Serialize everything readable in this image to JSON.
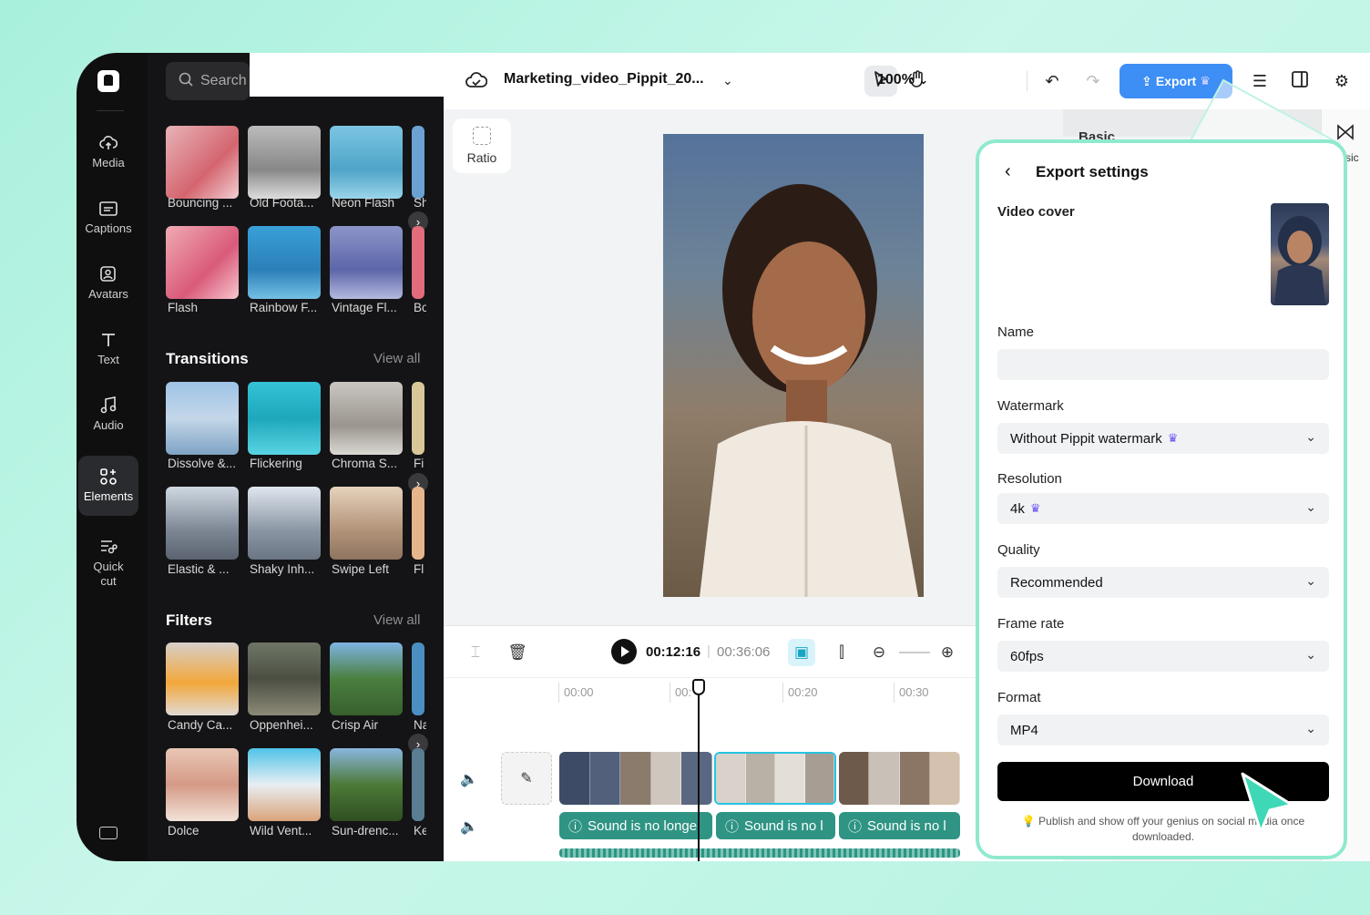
{
  "rail": {
    "items": [
      {
        "label": "Media",
        "icon": "cloud-icon"
      },
      {
        "label": "Captions",
        "icon": "captions-icon"
      },
      {
        "label": "Avatars",
        "icon": "avatar-icon"
      },
      {
        "label": "Text",
        "icon": "text-icon"
      },
      {
        "label": "Audio",
        "icon": "music-icon"
      },
      {
        "label": "Elements",
        "icon": "elements-icon"
      },
      {
        "label": "Quick cut",
        "icon": "quick-cut-icon"
      }
    ],
    "active": "Elements"
  },
  "library": {
    "search_placeholder": "Search",
    "effects_row1": [
      "Bouncing ...",
      "Old Foota...",
      "Neon Flash",
      "Sh"
    ],
    "effects_row2": [
      "Flash",
      "Rainbow F...",
      "Vintage Fl...",
      "Bo"
    ],
    "transitions": {
      "title": "Transitions",
      "view_all": "View all",
      "row1": [
        "Dissolve &...",
        "Flickering",
        "Chroma S...",
        "Fi"
      ],
      "row2": [
        "Elastic & ...",
        "Shaky Inh...",
        "Swipe Left",
        "Fl"
      ]
    },
    "filters": {
      "title": "Filters",
      "view_all": "View all",
      "row1": [
        "Candy Ca...",
        "Oppenhei...",
        "Crisp Air",
        "Na"
      ],
      "row2": [
        "Dolce",
        "Wild Vent...",
        "Sun-drenc...",
        "Ke"
      ]
    }
  },
  "topbar": {
    "project_title": "Marketing_video_Pippit_20...",
    "zoom": "100%",
    "export_label": "Export"
  },
  "canvas": {
    "ratio_label": "Ratio",
    "basic_label": "Basic",
    "side_label": "sic"
  },
  "timeline": {
    "current_time": "00:12:16",
    "separator": "|",
    "total_time": "00:36:06",
    "ticks": [
      "00:00",
      "00:",
      "00:20",
      "00:30"
    ],
    "audio_clips": [
      "Sound is no longe",
      "Sound is no l",
      "Sound is no l"
    ]
  },
  "export_settings": {
    "title": "Export settings",
    "video_cover_label": "Video cover",
    "name_label": "Name",
    "name_value": "",
    "watermark_label": "Watermark",
    "watermark_value": "Without Pippit watermark",
    "resolution_label": "Resolution",
    "resolution_value": "4k",
    "quality_label": "Quality",
    "quality_value": "Recommended",
    "frame_rate_label": "Frame rate",
    "frame_rate_value": "60fps",
    "format_label": "Format",
    "format_value": "MP4",
    "download_label": "Download",
    "note": "Publish and show off your genius on social media once downloaded."
  },
  "colors": {
    "accent": "#3d8ef5",
    "panel_border": "#8fe9cf",
    "audio_clip": "#2f9484",
    "premium": "#6a55f5"
  }
}
